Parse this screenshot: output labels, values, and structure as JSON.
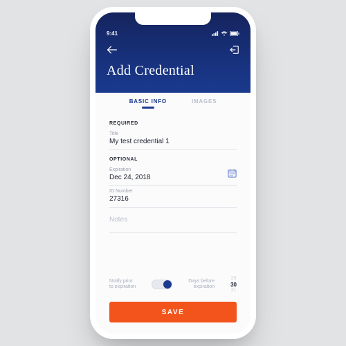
{
  "status": {
    "time": "9:41"
  },
  "header": {
    "title": "Add Credential"
  },
  "tabs": {
    "basic": "BASIC INFO",
    "images": "IMAGES"
  },
  "sections": {
    "required": "REQUIRED",
    "optional": "OPTIONAL"
  },
  "fields": {
    "title": {
      "label": "Title",
      "value": "My test credential 1"
    },
    "expiration": {
      "label": "Expiration",
      "value": "Dec 24, 2018"
    },
    "idnumber": {
      "label": "ID Number",
      "value": "27316"
    },
    "notes": {
      "placeholder": "Notes"
    }
  },
  "notify": {
    "label_left_l1": "Notify prior",
    "label_left_l2": "to expiration",
    "label_right_l1": "Days before",
    "label_right_l2": "expiration",
    "days_prev": "29",
    "days_sel": "30",
    "days_next": "31"
  },
  "actions": {
    "save": "SAVE"
  },
  "colors": {
    "accent": "#1a3a8e",
    "action": "#f2541b"
  }
}
